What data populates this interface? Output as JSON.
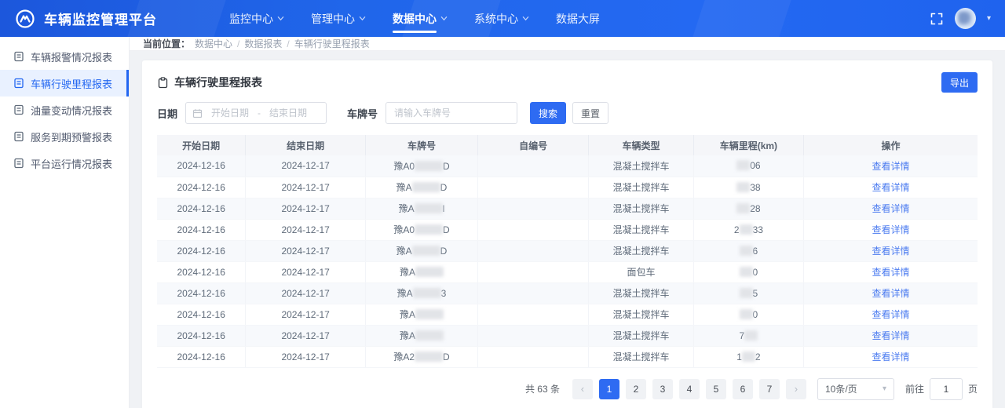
{
  "colors": {
    "primary": "#2e6bf2",
    "navbar": "#2066ea",
    "link": "#4c7cf0",
    "sidebar_active_bg": "#e9f1ff"
  },
  "navbar": {
    "brand": "车辆监控管理平台",
    "menu": [
      {
        "label": "监控中心",
        "dropdown": true,
        "active": false
      },
      {
        "label": "管理中心",
        "dropdown": true,
        "active": false
      },
      {
        "label": "数据中心",
        "dropdown": true,
        "active": true
      },
      {
        "label": "系统中心",
        "dropdown": true,
        "active": false
      },
      {
        "label": "数据大屏",
        "dropdown": false,
        "active": false
      }
    ]
  },
  "sidebar": {
    "items": [
      {
        "label": "车辆报警情况报表",
        "icon": "alarm-report-icon",
        "active": false
      },
      {
        "label": "车辆行驶里程报表",
        "icon": "mileage-report-icon",
        "active": true
      },
      {
        "label": "油量变动情况报表",
        "icon": "fuel-report-icon",
        "active": false
      },
      {
        "label": "服务到期预警报表",
        "icon": "service-warning-icon",
        "active": false
      },
      {
        "label": "平台运行情况报表",
        "icon": "platform-report-icon",
        "active": false
      }
    ]
  },
  "breadcrumb": {
    "prefix": "当前位置：",
    "separator": "/",
    "items": {
      "0": "数据中心",
      "1": "数据报表",
      "2": "车辆行驶里程报表"
    }
  },
  "page": {
    "title": "车辆行驶里程报表",
    "export_label": "导出"
  },
  "filters": {
    "date_label": "日期",
    "date_start_placeholder": "开始日期",
    "date_separator": "-",
    "date_end_placeholder": "结束日期",
    "plate_label": "车牌号",
    "plate_placeholder": "请输入车牌号",
    "search_label": "搜索",
    "reset_label": "重置"
  },
  "table": {
    "columns": {
      "0": "开始日期",
      "1": "结束日期",
      "2": "车牌号",
      "3": "自编号",
      "4": "车辆类型",
      "5": "车辆里程(km)",
      "6": "操作"
    },
    "action_label": "查看详情",
    "rows": [
      {
        "start": "2024-12-16",
        "end": "2024-12-17",
        "plate": {
          "prefix": "豫A0",
          "suffix": "D"
        },
        "self_no": "",
        "type": "混凝土搅拌车",
        "mileage": {
          "prefix": "",
          "suffix": "06"
        }
      },
      {
        "start": "2024-12-16",
        "end": "2024-12-17",
        "plate": {
          "prefix": "豫A",
          "suffix": "D"
        },
        "self_no": "",
        "type": "混凝土搅拌车",
        "mileage": {
          "prefix": "",
          "suffix": "38"
        }
      },
      {
        "start": "2024-12-16",
        "end": "2024-12-17",
        "plate": {
          "prefix": "豫A",
          "suffix": "l"
        },
        "self_no": "",
        "type": "混凝土搅拌车",
        "mileage": {
          "prefix": "",
          "suffix": "28"
        }
      },
      {
        "start": "2024-12-16",
        "end": "2024-12-17",
        "plate": {
          "prefix": "豫A0",
          "suffix": "D"
        },
        "self_no": "",
        "type": "混凝土搅拌车",
        "mileage": {
          "prefix": "2",
          "suffix": "33"
        }
      },
      {
        "start": "2024-12-16",
        "end": "2024-12-17",
        "plate": {
          "prefix": "豫A",
          "suffix": "D"
        },
        "self_no": "",
        "type": "混凝土搅拌车",
        "mileage": {
          "prefix": "",
          "suffix": "6"
        }
      },
      {
        "start": "2024-12-16",
        "end": "2024-12-17",
        "plate": {
          "prefix": "豫A",
          "suffix": ""
        },
        "self_no": "",
        "type": "面包车",
        "mileage": {
          "prefix": "",
          "suffix": "0"
        }
      },
      {
        "start": "2024-12-16",
        "end": "2024-12-17",
        "plate": {
          "prefix": "豫A",
          "suffix": "3"
        },
        "self_no": "",
        "type": "混凝土搅拌车",
        "mileage": {
          "prefix": "",
          "suffix": "5"
        }
      },
      {
        "start": "2024-12-16",
        "end": "2024-12-17",
        "plate": {
          "prefix": "豫A",
          "suffix": ""
        },
        "self_no": "",
        "type": "混凝土搅拌车",
        "mileage": {
          "prefix": "",
          "suffix": "0"
        }
      },
      {
        "start": "2024-12-16",
        "end": "2024-12-17",
        "plate": {
          "prefix": "豫A",
          "suffix": ""
        },
        "self_no": "",
        "type": "混凝土搅拌车",
        "mileage": {
          "prefix": "7",
          "suffix": ""
        }
      },
      {
        "start": "2024-12-16",
        "end": "2024-12-17",
        "plate": {
          "prefix": "豫A2",
          "suffix": "D"
        },
        "self_no": "",
        "type": "混凝土搅拌车",
        "mileage": {
          "prefix": "1",
          "suffix": "2"
        }
      }
    ]
  },
  "pagination": {
    "total_label": "共 63 条",
    "prev_icon": "‹",
    "next_icon": "›",
    "pages": [
      {
        "label": "1",
        "active": true
      },
      {
        "label": "2",
        "active": false
      },
      {
        "label": "3",
        "active": false
      },
      {
        "label": "4",
        "active": false
      },
      {
        "label": "5",
        "active": false
      },
      {
        "label": "6",
        "active": false
      },
      {
        "label": "7",
        "active": false
      }
    ],
    "page_size": "10条/页",
    "goto_label": "前往",
    "goto_value": "1",
    "goto_suffix": "页"
  }
}
